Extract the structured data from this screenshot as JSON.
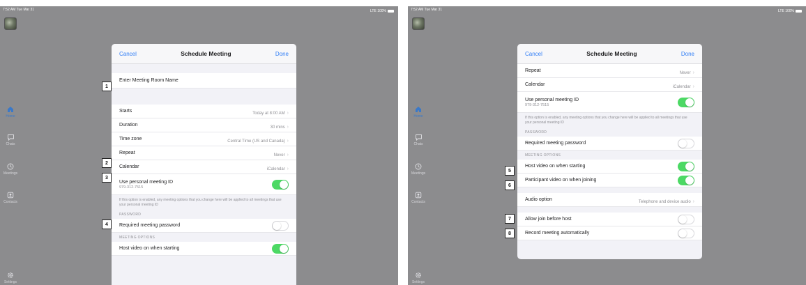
{
  "left": {
    "status": {
      "time": "7:52 AM  Tue Mar 31",
      "signal": "LTE 100%"
    },
    "nav": [
      {
        "label": "Home",
        "icon": "home-icon",
        "active": true
      },
      {
        "label": "Chats",
        "icon": "chat-icon",
        "active": false
      },
      {
        "label": "Meetings",
        "icon": "clock-icon",
        "active": false
      },
      {
        "label": "Contacts",
        "icon": "contacts-icon",
        "active": false
      },
      {
        "label": "Settings",
        "icon": "gear-icon",
        "active": false
      }
    ],
    "modal": {
      "cancel": "Cancel",
      "title": "Schedule Meeting",
      "done": "Done",
      "name_placeholder": "Enter Meeting Room Name",
      "starts_label": "Starts",
      "starts_value": "Today at 8:00 AM",
      "duration_label": "Duration",
      "duration_value": "30 mins",
      "timezone_label": "Time zone",
      "timezone_value": "Central Time (US and Canada)",
      "repeat_label": "Repeat",
      "repeat_value": "Never",
      "calendar_label": "Calendar",
      "calendar_value": "iCalendar",
      "pmi_label": "Use personal meeting ID",
      "pmi_value": "979-312-7515",
      "pmi_note": "If this option is enabled, any meeting options that you change here will be applied to all meetings that use your personal meeting ID",
      "password_section": "PASSWORD",
      "password_label": "Required meeting password",
      "options_section": "MEETING OPTIONS",
      "host_video_label": "Host video on when starting"
    },
    "badges": [
      "1",
      "2",
      "3",
      "4"
    ]
  },
  "right": {
    "status": {
      "time": "7:52 AM  Tue Mar 31",
      "signal": "LTE 100%"
    },
    "nav": [
      {
        "label": "Home",
        "icon": "home-icon",
        "active": true
      },
      {
        "label": "Chats",
        "icon": "chat-icon",
        "active": false
      },
      {
        "label": "Meetings",
        "icon": "clock-icon",
        "active": false
      },
      {
        "label": "Contacts",
        "icon": "contacts-icon",
        "active": false
      },
      {
        "label": "Settings",
        "icon": "gear-icon",
        "active": false
      }
    ],
    "modal": {
      "cancel": "Cancel",
      "title": "Schedule Meeting",
      "done": "Done",
      "repeat_label": "Repeat",
      "repeat_value": "Never",
      "calendar_label": "Calendar",
      "calendar_value": "iCalendar",
      "pmi_label": "Use personal meeting ID",
      "pmi_value": "979-312-7515",
      "pmi_note": "If this option is enabled, any meeting options that you change here will be applied to all meetings that use your personal meeting ID",
      "password_section": "PASSWORD",
      "password_label": "Required meeting password",
      "options_section": "MEETING OPTIONS",
      "host_video_label": "Host video on when starting",
      "participant_video_label": "Participant video on when joining",
      "audio_label": "Audio option",
      "audio_value": "Telephone and device audio",
      "join_before_label": "Allow join before host",
      "record_label": "Record meeting automatically"
    },
    "badges": [
      "5",
      "6",
      "7",
      "8"
    ]
  },
  "colors": {
    "accent": "#2f7df6",
    "toggle_on": "#4cd964",
    "backdrop": "#8c8c8e"
  }
}
